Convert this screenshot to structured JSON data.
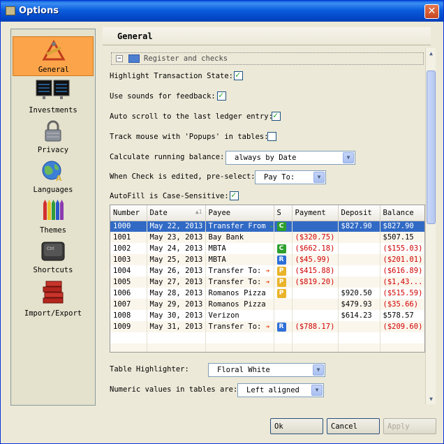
{
  "window": {
    "title": "Options"
  },
  "sidebar": {
    "items": [
      {
        "label": "General",
        "icon": "general-tools-icon",
        "active": true
      },
      {
        "label": "Investments",
        "icon": "investments-monitor-icon"
      },
      {
        "label": "Privacy",
        "icon": "padlock-icon"
      },
      {
        "label": "Languages",
        "icon": "globe-icon"
      },
      {
        "label": "Themes",
        "icon": "crayons-icon"
      },
      {
        "label": "Shortcuts",
        "icon": "keyboard-key-icon"
      },
      {
        "label": "Import/Export",
        "icon": "books-icon"
      }
    ]
  },
  "main": {
    "title": "General",
    "section": {
      "title": "Register and checks",
      "toggle": "−"
    },
    "options": {
      "highlight_state": {
        "label": "Highlight Transaction State:",
        "checked": true
      },
      "sounds": {
        "label": "Use sounds for feedback:",
        "checked": true
      },
      "autoscroll": {
        "label": "Auto scroll to the last ledger entry:",
        "checked": true
      },
      "track_mouse": {
        "label": "Track mouse with 'Popups' in tables:",
        "checked": false
      },
      "running_balance": {
        "label": "Calculate running balance:",
        "value": "always by Date"
      },
      "check_edited": {
        "label": "When Check is edited, pre-select:",
        "value": "Pay To:"
      },
      "autofill": {
        "label": "AutoFill is Case-Sensitive:",
        "checked": true
      },
      "table_highlighter": {
        "label": "Table Highlighter:",
        "value": "Floral White"
      },
      "numeric_values": {
        "label": "Numeric values in tables are:",
        "value": "Left aligned"
      }
    },
    "ledger": {
      "columns": [
        "Number",
        "Date",
        "Payee",
        "S",
        "Payment",
        "Deposit",
        "Balance"
      ],
      "sort_indicator": "▲1",
      "rows": [
        {
          "number": "1000",
          "date": "May 22, 2013",
          "payee": "Transfer From",
          "arrow": "green",
          "status": "C",
          "payment": "",
          "deposit": "$827.90",
          "balance": "$827.90",
          "balance_negative": false,
          "selected": true
        },
        {
          "number": "1001",
          "date": "May 23, 2013",
          "payee": "Bay Bank",
          "arrow": "",
          "status": "",
          "payment": "($320.75)",
          "deposit": "",
          "balance": "$507.15",
          "balance_negative": false
        },
        {
          "number": "1002",
          "date": "May 24, 2013",
          "payee": "MBTA",
          "arrow": "",
          "status": "C",
          "payment": "($662.18)",
          "deposit": "",
          "balance": "($155.03)",
          "balance_negative": true
        },
        {
          "number": "1003",
          "date": "May 25, 2013",
          "payee": "MBTA",
          "arrow": "",
          "status": "R",
          "payment": "($45.99)",
          "deposit": "",
          "balance": "($201.01)",
          "balance_negative": true
        },
        {
          "number": "1004",
          "date": "May 26, 2013",
          "payee": "Transfer To:",
          "arrow": "red",
          "status": "P",
          "payment": "($415.88)",
          "deposit": "",
          "balance": "($616.89)",
          "balance_negative": true
        },
        {
          "number": "1005",
          "date": "May 27, 2013",
          "payee": "Transfer To:",
          "arrow": "red",
          "status": "P",
          "payment": "($819.20)",
          "deposit": "",
          "balance": "($1,43...",
          "balance_negative": true
        },
        {
          "number": "1006",
          "date": "May 28, 2013",
          "payee": "Romanos Pizza",
          "arrow": "",
          "status": "P",
          "payment": "",
          "deposit": "$920.50",
          "balance": "($515.59)",
          "balance_negative": true
        },
        {
          "number": "1007",
          "date": "May 29, 2013",
          "payee": "Romanos Pizza",
          "arrow": "",
          "status": "",
          "payment": "",
          "deposit": "$479.93",
          "balance": "($35.66)",
          "balance_negative": true
        },
        {
          "number": "1008",
          "date": "May 30, 2013",
          "payee": "Verizon",
          "arrow": "",
          "status": "",
          "payment": "",
          "deposit": "$614.23",
          "balance": "$578.57",
          "balance_negative": false
        },
        {
          "number": "1009",
          "date": "May 31, 2013",
          "payee": "Transfer To:",
          "arrow": "red",
          "status": "R",
          "payment": "($788.17)",
          "deposit": "",
          "balance": "($209.60)",
          "balance_negative": true
        }
      ],
      "empty_rows": 2
    }
  },
  "footer": {
    "ok": "Ok",
    "cancel": "Cancel",
    "apply": "Apply"
  },
  "colors": {
    "selection": "#316ac5",
    "negative": "#d00000",
    "active_nav": "#fba44a",
    "title_bar": "#0b5ddd"
  }
}
